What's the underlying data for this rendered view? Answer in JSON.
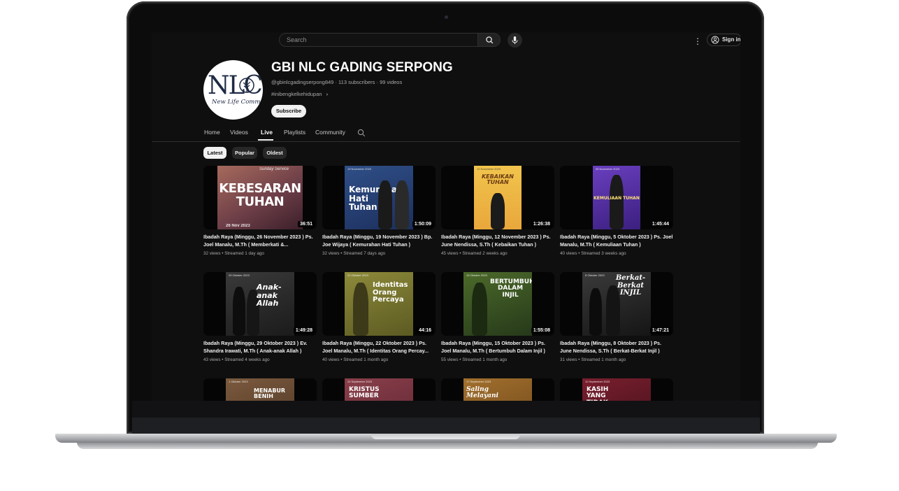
{
  "search": {
    "placeholder": "Search"
  },
  "header": {
    "signin_label": "Sign in"
  },
  "channel": {
    "logo_text": "NLC",
    "logo_script": "New Life Community",
    "title": "GBI NLC GADING SERPONG",
    "handle": "@gbinlcgadingserpong849",
    "subscribers": "113 subscribers",
    "videos": "99 videos",
    "meta_sep": "·",
    "description": "#inibengkelkehidupan",
    "subscribe_label": "Subscribe"
  },
  "tabs": [
    {
      "label": "Home"
    },
    {
      "label": "Videos"
    },
    {
      "label": "Live",
      "active": true
    },
    {
      "label": "Playlists"
    },
    {
      "label": "Community"
    }
  ],
  "chips": [
    {
      "label": "Latest",
      "active": true
    },
    {
      "label": "Popular"
    },
    {
      "label": "Oldest"
    }
  ],
  "videos": [
    {
      "title": "Ibadah Raya (Minggu, 26 November 2023 ) Ps. Joel Manalu, M.Th ( Memberkati &...",
      "views": "32 views",
      "streamed": "Streamed 1 day ago",
      "duration": "36:51",
      "poster_text": "KEBESARAN TUHAN",
      "poster_top": "Sunday Service",
      "poster_date": "26 Nov 2023"
    },
    {
      "title": "Ibadah Raya (Minggu, 19 November 2023 ) Bp. Joe Wijaya ( Kemurahan Hati Tuhan )",
      "views": "32 views",
      "streamed": "Streamed 7 days ago",
      "duration": "1:50:09",
      "poster_text": "Kemurahan Hati Tuhan",
      "poster_top": "19 November 2023"
    },
    {
      "title": "Ibadah Raya (Minggu, 12 November 2023 ) Ps. June Nendissa, S.Th ( Kebaikan Tuhan )",
      "views": "45 views",
      "streamed": "Streamed 2 weeks ago",
      "duration": "1:26:38",
      "poster_text": "KEBAIKAN TUHAN",
      "poster_top": "12 November 2023"
    },
    {
      "title": "Ibadah Raya (Minggu, 5 Oktober 2023 ) Ps. Joel Manalu, M.Th ( Kemuliaan Tuhan )",
      "views": "40 views",
      "streamed": "Streamed 3 weeks ago",
      "duration": "1:45:44",
      "poster_text": "KEMULIAAN TUHAN",
      "poster_top": "05 November 2023"
    },
    {
      "title": "Ibadah Raya (Minggu, 29 Oktober 2023 ) Ev. Shandra Irawati, M.Th ( Anak-anak Allah )",
      "views": "43 views",
      "streamed": "Streamed 4 weeks ago",
      "duration": "1:49:28",
      "poster_text": "Anak-anak Allah",
      "poster_top": "29 Oktober 2023"
    },
    {
      "title": "Ibadah Raya (Minggu, 22 Oktober 2023 ) Ps. Joel Manalu, M.Th ( Identitas Orang Percay...",
      "views": "40 views",
      "streamed": "Streamed 1 month ago",
      "duration": "44:16",
      "poster_text": "Identitas Orang Percaya",
      "poster_top": "22 Oktober 2023"
    },
    {
      "title": "Ibadah Raya (Minggu, 15 Oktober 2023 ) Ps. Joel Manalu, M.Th ( Bertumbuh Dalam Injil )",
      "views": "55 views",
      "streamed": "Streamed 1 month ago",
      "duration": "1:55:08",
      "poster_text": "BERTUMBUH DALAM INJIL",
      "poster_top": "15 Oktober 2023"
    },
    {
      "title": "Ibadah Raya (Minggu, 8 Oktober 2023 ) Ps. June Nendissa, S.Th ( Berkat-Berkat Injil )",
      "views": "31 views",
      "streamed": "Streamed 1 month ago",
      "duration": "1:47:21",
      "poster_text": "Berkat-Berkat INJIL",
      "poster_top": "8 Oktober 2023"
    },
    {
      "poster_text": "MENABUR BENIH",
      "poster_top": "1 Oktober 2023"
    },
    {
      "poster_text": "KRISTUS SUMBER",
      "poster_top": "24 September 2023"
    },
    {
      "poster_text": "Saling Melayani",
      "poster_top": "17 September 2023"
    },
    {
      "poster_text": "KASIH YANG TIDAK",
      "poster_top": "10 September 2023"
    }
  ],
  "colors": {
    "background": "#0f0f0f",
    "text": "#f1f1f1",
    "secondary_text": "#aaaaaa",
    "chip": "#272727"
  }
}
